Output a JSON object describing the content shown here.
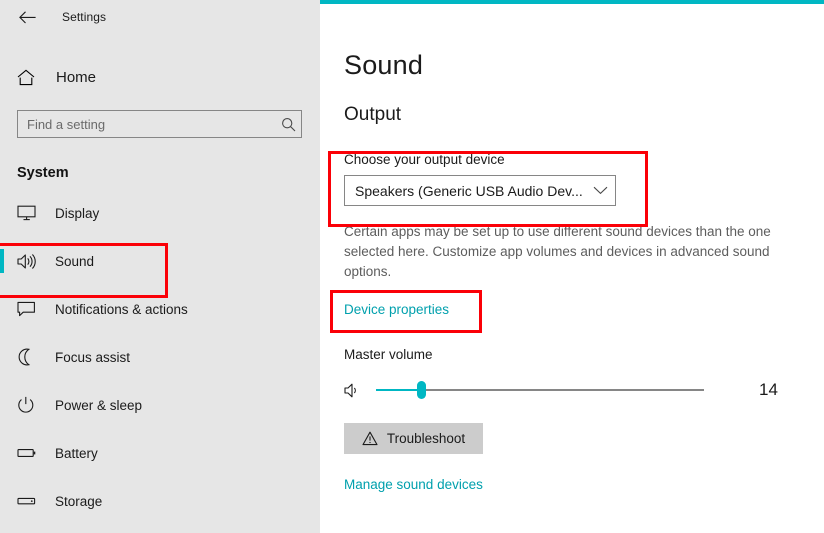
{
  "window": {
    "title": "Settings",
    "back_icon": "back-arrow-icon"
  },
  "sidebar": {
    "home": {
      "label": "Home",
      "icon": "home-icon"
    },
    "search": {
      "placeholder": "Find a setting",
      "value": "",
      "icon": "search-icon"
    },
    "section_title": "System",
    "items": [
      {
        "label": "Display",
        "icon": "monitor-icon",
        "selected": false
      },
      {
        "label": "Sound",
        "icon": "speaker-icon",
        "selected": true
      },
      {
        "label": "Notifications & actions",
        "icon": "message-icon",
        "selected": false
      },
      {
        "label": "Focus assist",
        "icon": "moon-icon",
        "selected": false
      },
      {
        "label": "Power & sleep",
        "icon": "power-icon",
        "selected": false
      },
      {
        "label": "Battery",
        "icon": "battery-icon",
        "selected": false
      },
      {
        "label": "Storage",
        "icon": "storage-icon",
        "selected": false
      }
    ]
  },
  "main": {
    "page_title": "Sound",
    "output_heading": "Output",
    "output_device_label": "Choose your output device",
    "output_device_value": "Speakers (Generic USB Audio Dev...",
    "output_device_chevron": "chevron-down-icon",
    "output_description": "Certain apps may be set up to use different sound devices than the one selected here. Customize app volumes and devices in advanced sound options.",
    "device_properties_link": "Device properties",
    "master_volume_label": "Master volume",
    "volume_icon": "speaker-icon",
    "volume_value": "14",
    "volume_percent": 14,
    "troubleshoot_label": "Troubleshoot",
    "troubleshoot_icon": "warning-triangle-icon",
    "manage_sound_devices_link": "Manage sound devices"
  },
  "colors": {
    "accent": "#00b7c3",
    "link": "#00a0ad",
    "annotation": "#fb0007",
    "sidebar_bg": "#e6e6e6",
    "button_bg": "#cccccc"
  }
}
